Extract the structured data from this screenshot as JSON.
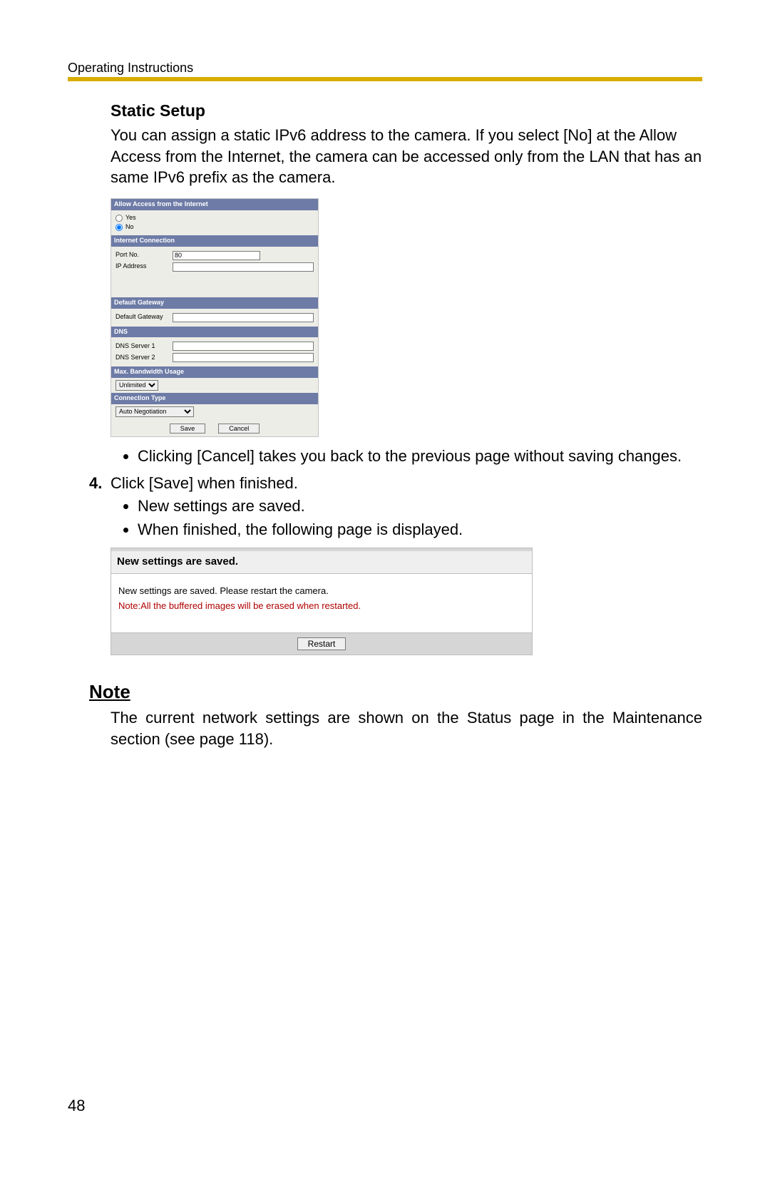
{
  "header": {
    "running_title": "Operating Instructions"
  },
  "page_number": "48",
  "section": {
    "title": "Static Setup",
    "intro": "You can assign a static IPv6 address to the camera. If you select [No] at the Allow Access from the Internet, the camera can be accessed only from the LAN that has an same IPv6 prefix as the camera."
  },
  "form": {
    "hdr_allow": "Allow Access from the Internet",
    "opt_yes": "Yes",
    "opt_no": "No",
    "selected_option": "No",
    "hdr_internet": "Internet Connection",
    "lbl_port": "Port No.",
    "val_port": "80",
    "lbl_ip": "IP Address",
    "val_ip": "",
    "hdr_gateway": "Default Gateway",
    "lbl_default_gw": "Default Gateway",
    "val_default_gw": "",
    "hdr_dns": "DNS",
    "lbl_dns1": "DNS Server 1",
    "val_dns1": "",
    "lbl_dns2": "DNS Server 2",
    "val_dns2": "",
    "hdr_bw": "Max. Bandwidth Usage",
    "sel_bw": "Unlimited",
    "hdr_conn": "Connection Type",
    "sel_conn": "Auto Negotiation",
    "btn_save": "Save",
    "btn_cancel": "Cancel"
  },
  "bullets_after_form": [
    "Clicking [Cancel] takes you back to the previous page without saving changes."
  ],
  "step4": {
    "number": "4.",
    "text": "Click [Save] when finished.",
    "sub_bullets": [
      "New settings are saved.",
      "When finished, the following page is displayed."
    ]
  },
  "saved_dialog": {
    "title": "New settings are saved.",
    "msg1": "New settings are saved. Please restart the camera.",
    "msg_red": "Note:All the buffered images will be erased when restarted.",
    "btn_restart": "Restart"
  },
  "note": {
    "heading": "Note",
    "text": "The current network settings are shown on the Status page in the Maintenance section (see page 118)."
  }
}
